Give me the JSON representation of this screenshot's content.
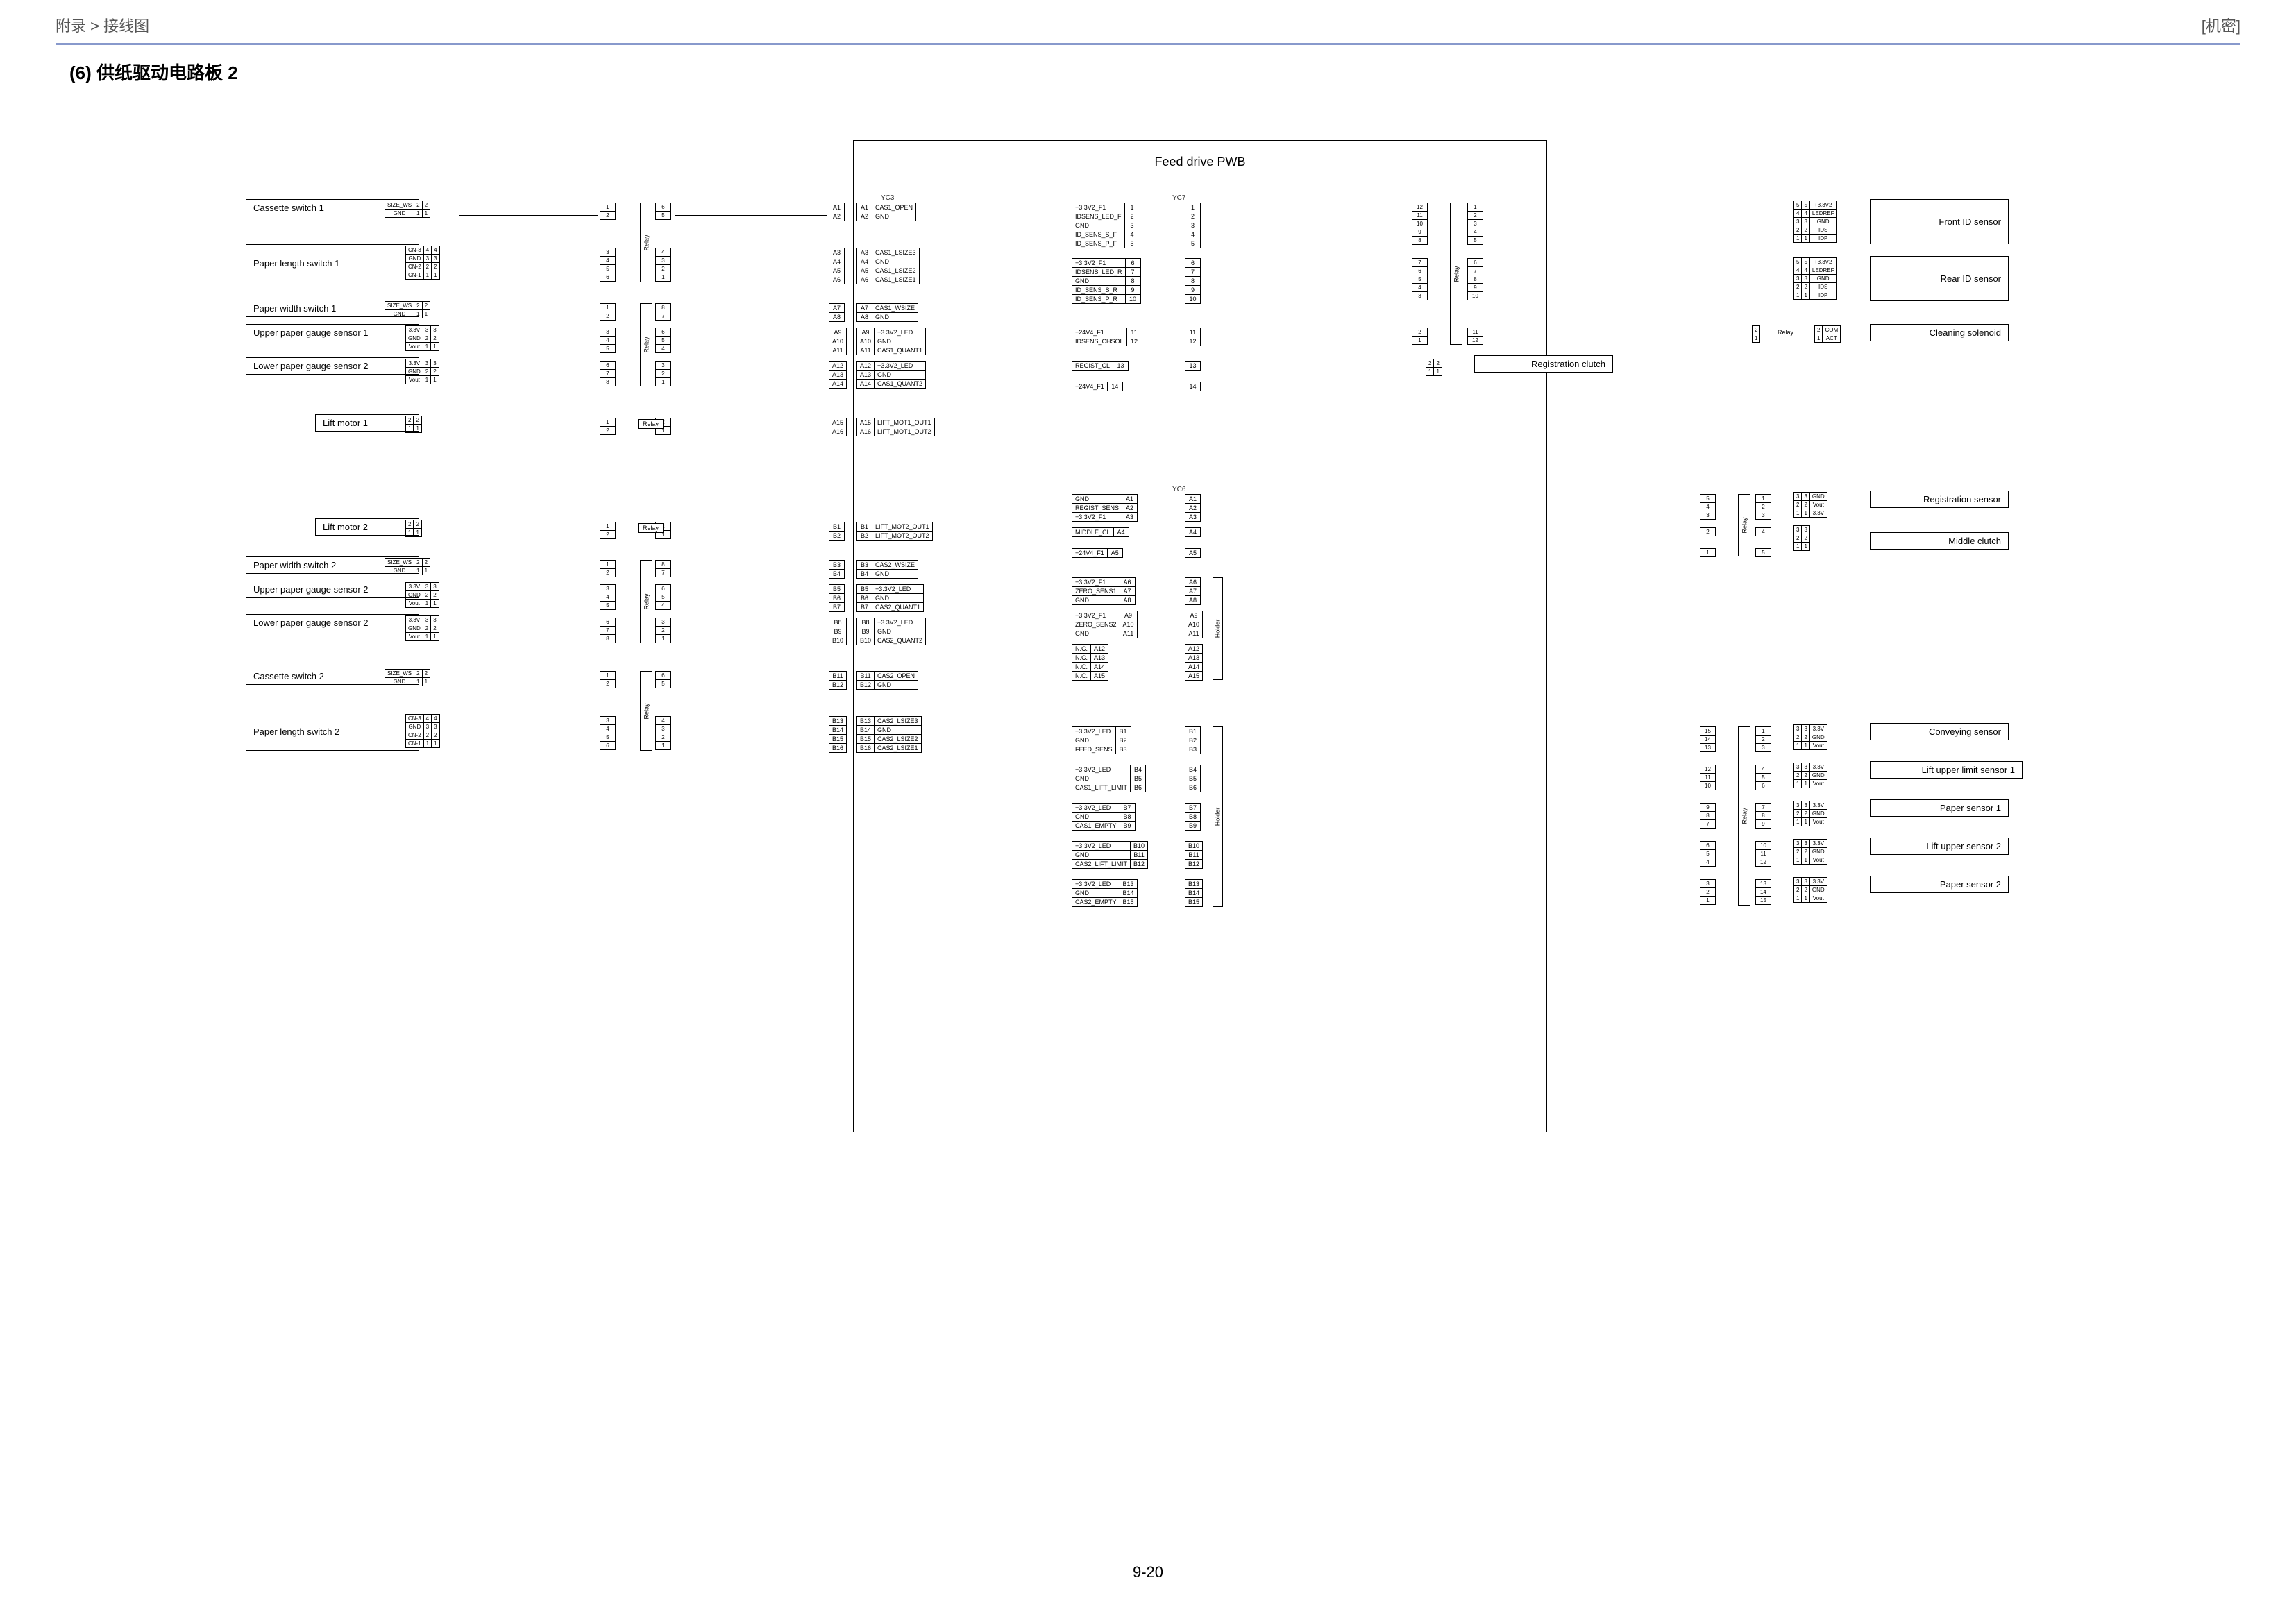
{
  "header_left": "附录 > 接线图",
  "header_right": "[机密]",
  "section_title": "(6) 供纸驱动电路板 2",
  "page_num": "9-20",
  "pwb_title": "Feed drive PWB",
  "relay": "Relay",
  "holder": "Holder",
  "conn": {
    "yc3": "YC3",
    "yc7": "YC7",
    "yc6": "YC6"
  },
  "left_components": {
    "cassette_sw1": "Cassette switch 1",
    "paper_len_sw1": "Paper length switch 1",
    "paper_width_sw1": "Paper width switch 1",
    "upper_gauge1": "Upper paper gauge sensor 1",
    "lower_gauge1": "Lower paper gauge sensor 2",
    "lift_motor1": "Lift motor 1",
    "lift_motor2": "Lift motor 2",
    "paper_width_sw2": "Paper width switch 2",
    "upper_gauge2": "Upper paper gauge sensor 2",
    "lower_gauge2": "Lower paper gauge sensor 2",
    "cassette_sw2": "Cassette switch 2",
    "paper_len_sw2": "Paper length switch 2"
  },
  "right_components": {
    "front_id": "Front ID sensor",
    "rear_id": "Rear ID sensor",
    "clean_sol": "Cleaning solenoid",
    "reg_clutch": "Registration clutch",
    "reg_sensor": "Registration sensor",
    "mid_clutch": "Middle clutch",
    "conv_sensor": "Conveying sensor",
    "lift_upper1": "Lift upper limit sensor 1",
    "paper_sensor1": "Paper sensor 1",
    "lift_upper2": "Lift upper sensor 2",
    "paper_sensor2": "Paper sensor 2"
  },
  "yc3_signals": {
    "a1": "CAS1_OPEN",
    "a2": "GND",
    "a3": "CAS1_LSIZE3",
    "a4": "GND",
    "a5": "CAS1_LSIZE2",
    "a6": "CAS1_LSIZE1",
    "a7": "CAS1_WSIZE",
    "a8": "GND",
    "a9": "+3.3V2_LED",
    "a10": "GND",
    "a11": "CAS1_QUANT1",
    "a12": "+3.3V2_LED",
    "a13": "GND",
    "a14": "CAS1_QUANT2",
    "a15": "LIFT_MOT1_OUT1",
    "a16": "LIFT_MOT1_OUT2",
    "b1": "LIFT_MOT2_OUT1",
    "b2": "LIFT_MOT2_OUT2",
    "b3": "CAS2_WSIZE",
    "b4": "GND",
    "b5": "+3.3V2_LED",
    "b6": "GND",
    "b7": "CAS2_QUANT1",
    "b8": "+3.3V2_LED",
    "b9": "GND",
    "b10": "CAS2_QUANT2",
    "b11": "CAS2_OPEN",
    "b12": "GND",
    "b13": "CAS2_LSIZE3",
    "b14": "GND",
    "b15": "CAS2_LSIZE2",
    "b16": "CAS2_LSIZE1"
  },
  "yc7_signals": {
    "r1": "+3.3V2_F1",
    "r2": "IDSENS_LED_F",
    "r3": "GND",
    "r4": "ID_SENS_S_F",
    "r5": "ID_SENS_P_F",
    "r6": "+3.3V2_F1",
    "r7": "IDSENS_LED_R",
    "r8": "GND",
    "r9": "ID_SENS_S_R",
    "r10": "ID_SENS_P_R",
    "r11": "+24V4_F1",
    "r12": "IDSENS_CHSOL",
    "r13": "REGIST_CL",
    "r14": "+24V4_F1"
  },
  "yc6_signals": {
    "a1": "GND",
    "a2": "REGIST_SENS",
    "a3": "+3.3V2_F1",
    "a4": "MIDDLE_CL",
    "a5": "+24V4_F1",
    "a6": "+3.3V2_F1",
    "a7": "ZERO_SENS1",
    "a8": "GND",
    "a9": "+3.3V2_F1",
    "a10": "ZERO_SENS2",
    "a11": "GND",
    "a12": "N.C.",
    "a13": "N.C.",
    "a14": "N.C.",
    "a15": "N.C.",
    "b1": "+3.3V2_LED",
    "b2": "GND",
    "b3": "FEED_SENS",
    "b4": "+3.3V2_LED",
    "b5": "GND",
    "b6": "CAS1_LIFT_LIMIT",
    "b7": "+3.3V2_LED",
    "b8": "GND",
    "b9": "CAS1_EMPTY",
    "b10": "+3.3V2_LED",
    "b11": "GND",
    "b12": "CAS2_LIFT_LIMIT",
    "b13": "+3.3V2_LED",
    "b14": "GND",
    "b15": "CAS2_EMPTY"
  },
  "left_pins": {
    "size_ws": "SIZE_WS",
    "gnd": "GND",
    "cn3": "CN-3",
    "cn2": "CN-2",
    "cn1": "CN-1",
    "v33": "3.3V",
    "vout": "Vout"
  },
  "right_pins": {
    "v33": "+3.3V2",
    "ledref": "LEDREF",
    "gnd": "GND",
    "ids": "IDS",
    "idp": "IDP",
    "com": "COM",
    "act": "ACT",
    "vout": "Vout",
    "v33s": "3.3V"
  },
  "nums": {
    "1": "1",
    "2": "2",
    "3": "3",
    "4": "4",
    "5": "5",
    "6": "6",
    "7": "7",
    "8": "8",
    "9": "9",
    "10": "10",
    "11": "11",
    "12": "12",
    "13": "13",
    "14": "14",
    "15": "15",
    "16": "16"
  }
}
